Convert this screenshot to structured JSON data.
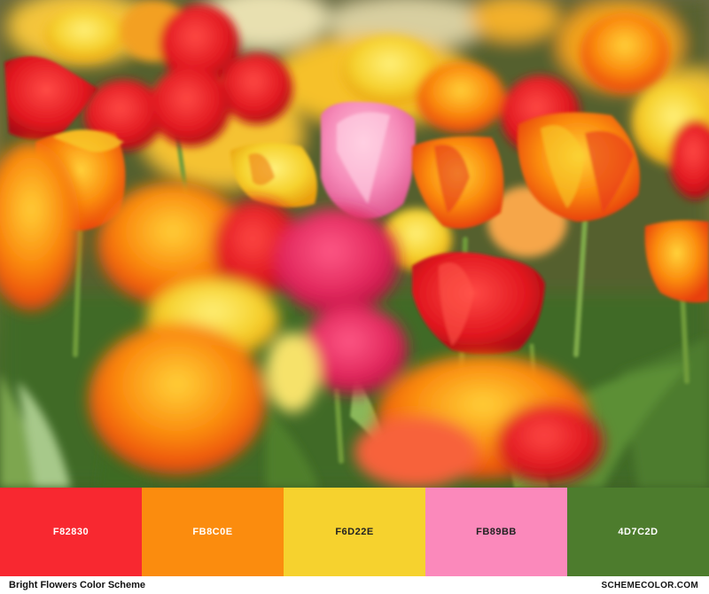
{
  "palette": [
    {
      "hex": "F82830",
      "color": "#F82830",
      "text_color": "#ffffff"
    },
    {
      "hex": "FB8C0E",
      "color": "#FB8C0E",
      "text_color": "#ffffff"
    },
    {
      "hex": "F6D22E",
      "color": "#F6D22E",
      "text_color": "#222222"
    },
    {
      "hex": "FB89BB",
      "color": "#FB89BB",
      "text_color": "#222222"
    },
    {
      "hex": "4D7C2D",
      "color": "#4D7C2D",
      "text_color": "#ffffff"
    }
  ],
  "footer": {
    "title": "Bright Flowers Color Scheme",
    "site": "SCHEMECOLOR.COM"
  }
}
